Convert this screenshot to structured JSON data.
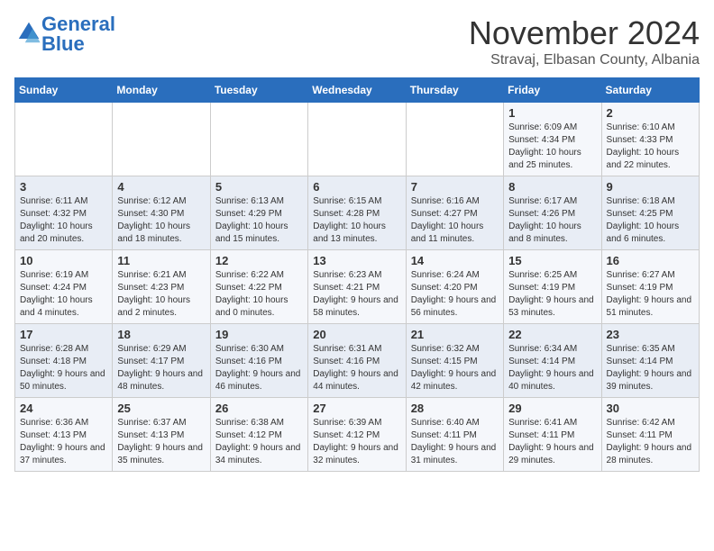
{
  "logo": {
    "text_general": "General",
    "text_blue": "Blue"
  },
  "header": {
    "month": "November 2024",
    "location": "Stravaj, Elbasan County, Albania"
  },
  "days_of_week": [
    "Sunday",
    "Monday",
    "Tuesday",
    "Wednesday",
    "Thursday",
    "Friday",
    "Saturday"
  ],
  "weeks": [
    [
      {
        "day": "",
        "info": ""
      },
      {
        "day": "",
        "info": ""
      },
      {
        "day": "",
        "info": ""
      },
      {
        "day": "",
        "info": ""
      },
      {
        "day": "",
        "info": ""
      },
      {
        "day": "1",
        "info": "Sunrise: 6:09 AM\nSunset: 4:34 PM\nDaylight: 10 hours and 25 minutes."
      },
      {
        "day": "2",
        "info": "Sunrise: 6:10 AM\nSunset: 4:33 PM\nDaylight: 10 hours and 22 minutes."
      }
    ],
    [
      {
        "day": "3",
        "info": "Sunrise: 6:11 AM\nSunset: 4:32 PM\nDaylight: 10 hours and 20 minutes."
      },
      {
        "day": "4",
        "info": "Sunrise: 6:12 AM\nSunset: 4:30 PM\nDaylight: 10 hours and 18 minutes."
      },
      {
        "day": "5",
        "info": "Sunrise: 6:13 AM\nSunset: 4:29 PM\nDaylight: 10 hours and 15 minutes."
      },
      {
        "day": "6",
        "info": "Sunrise: 6:15 AM\nSunset: 4:28 PM\nDaylight: 10 hours and 13 minutes."
      },
      {
        "day": "7",
        "info": "Sunrise: 6:16 AM\nSunset: 4:27 PM\nDaylight: 10 hours and 11 minutes."
      },
      {
        "day": "8",
        "info": "Sunrise: 6:17 AM\nSunset: 4:26 PM\nDaylight: 10 hours and 8 minutes."
      },
      {
        "day": "9",
        "info": "Sunrise: 6:18 AM\nSunset: 4:25 PM\nDaylight: 10 hours and 6 minutes."
      }
    ],
    [
      {
        "day": "10",
        "info": "Sunrise: 6:19 AM\nSunset: 4:24 PM\nDaylight: 10 hours and 4 minutes."
      },
      {
        "day": "11",
        "info": "Sunrise: 6:21 AM\nSunset: 4:23 PM\nDaylight: 10 hours and 2 minutes."
      },
      {
        "day": "12",
        "info": "Sunrise: 6:22 AM\nSunset: 4:22 PM\nDaylight: 10 hours and 0 minutes."
      },
      {
        "day": "13",
        "info": "Sunrise: 6:23 AM\nSunset: 4:21 PM\nDaylight: 9 hours and 58 minutes."
      },
      {
        "day": "14",
        "info": "Sunrise: 6:24 AM\nSunset: 4:20 PM\nDaylight: 9 hours and 56 minutes."
      },
      {
        "day": "15",
        "info": "Sunrise: 6:25 AM\nSunset: 4:19 PM\nDaylight: 9 hours and 53 minutes."
      },
      {
        "day": "16",
        "info": "Sunrise: 6:27 AM\nSunset: 4:19 PM\nDaylight: 9 hours and 51 minutes."
      }
    ],
    [
      {
        "day": "17",
        "info": "Sunrise: 6:28 AM\nSunset: 4:18 PM\nDaylight: 9 hours and 50 minutes."
      },
      {
        "day": "18",
        "info": "Sunrise: 6:29 AM\nSunset: 4:17 PM\nDaylight: 9 hours and 48 minutes."
      },
      {
        "day": "19",
        "info": "Sunrise: 6:30 AM\nSunset: 4:16 PM\nDaylight: 9 hours and 46 minutes."
      },
      {
        "day": "20",
        "info": "Sunrise: 6:31 AM\nSunset: 4:16 PM\nDaylight: 9 hours and 44 minutes."
      },
      {
        "day": "21",
        "info": "Sunrise: 6:32 AM\nSunset: 4:15 PM\nDaylight: 9 hours and 42 minutes."
      },
      {
        "day": "22",
        "info": "Sunrise: 6:34 AM\nSunset: 4:14 PM\nDaylight: 9 hours and 40 minutes."
      },
      {
        "day": "23",
        "info": "Sunrise: 6:35 AM\nSunset: 4:14 PM\nDaylight: 9 hours and 39 minutes."
      }
    ],
    [
      {
        "day": "24",
        "info": "Sunrise: 6:36 AM\nSunset: 4:13 PM\nDaylight: 9 hours and 37 minutes."
      },
      {
        "day": "25",
        "info": "Sunrise: 6:37 AM\nSunset: 4:13 PM\nDaylight: 9 hours and 35 minutes."
      },
      {
        "day": "26",
        "info": "Sunrise: 6:38 AM\nSunset: 4:12 PM\nDaylight: 9 hours and 34 minutes."
      },
      {
        "day": "27",
        "info": "Sunrise: 6:39 AM\nSunset: 4:12 PM\nDaylight: 9 hours and 32 minutes."
      },
      {
        "day": "28",
        "info": "Sunrise: 6:40 AM\nSunset: 4:11 PM\nDaylight: 9 hours and 31 minutes."
      },
      {
        "day": "29",
        "info": "Sunrise: 6:41 AM\nSunset: 4:11 PM\nDaylight: 9 hours and 29 minutes."
      },
      {
        "day": "30",
        "info": "Sunrise: 6:42 AM\nSunset: 4:11 PM\nDaylight: 9 hours and 28 minutes."
      }
    ]
  ]
}
